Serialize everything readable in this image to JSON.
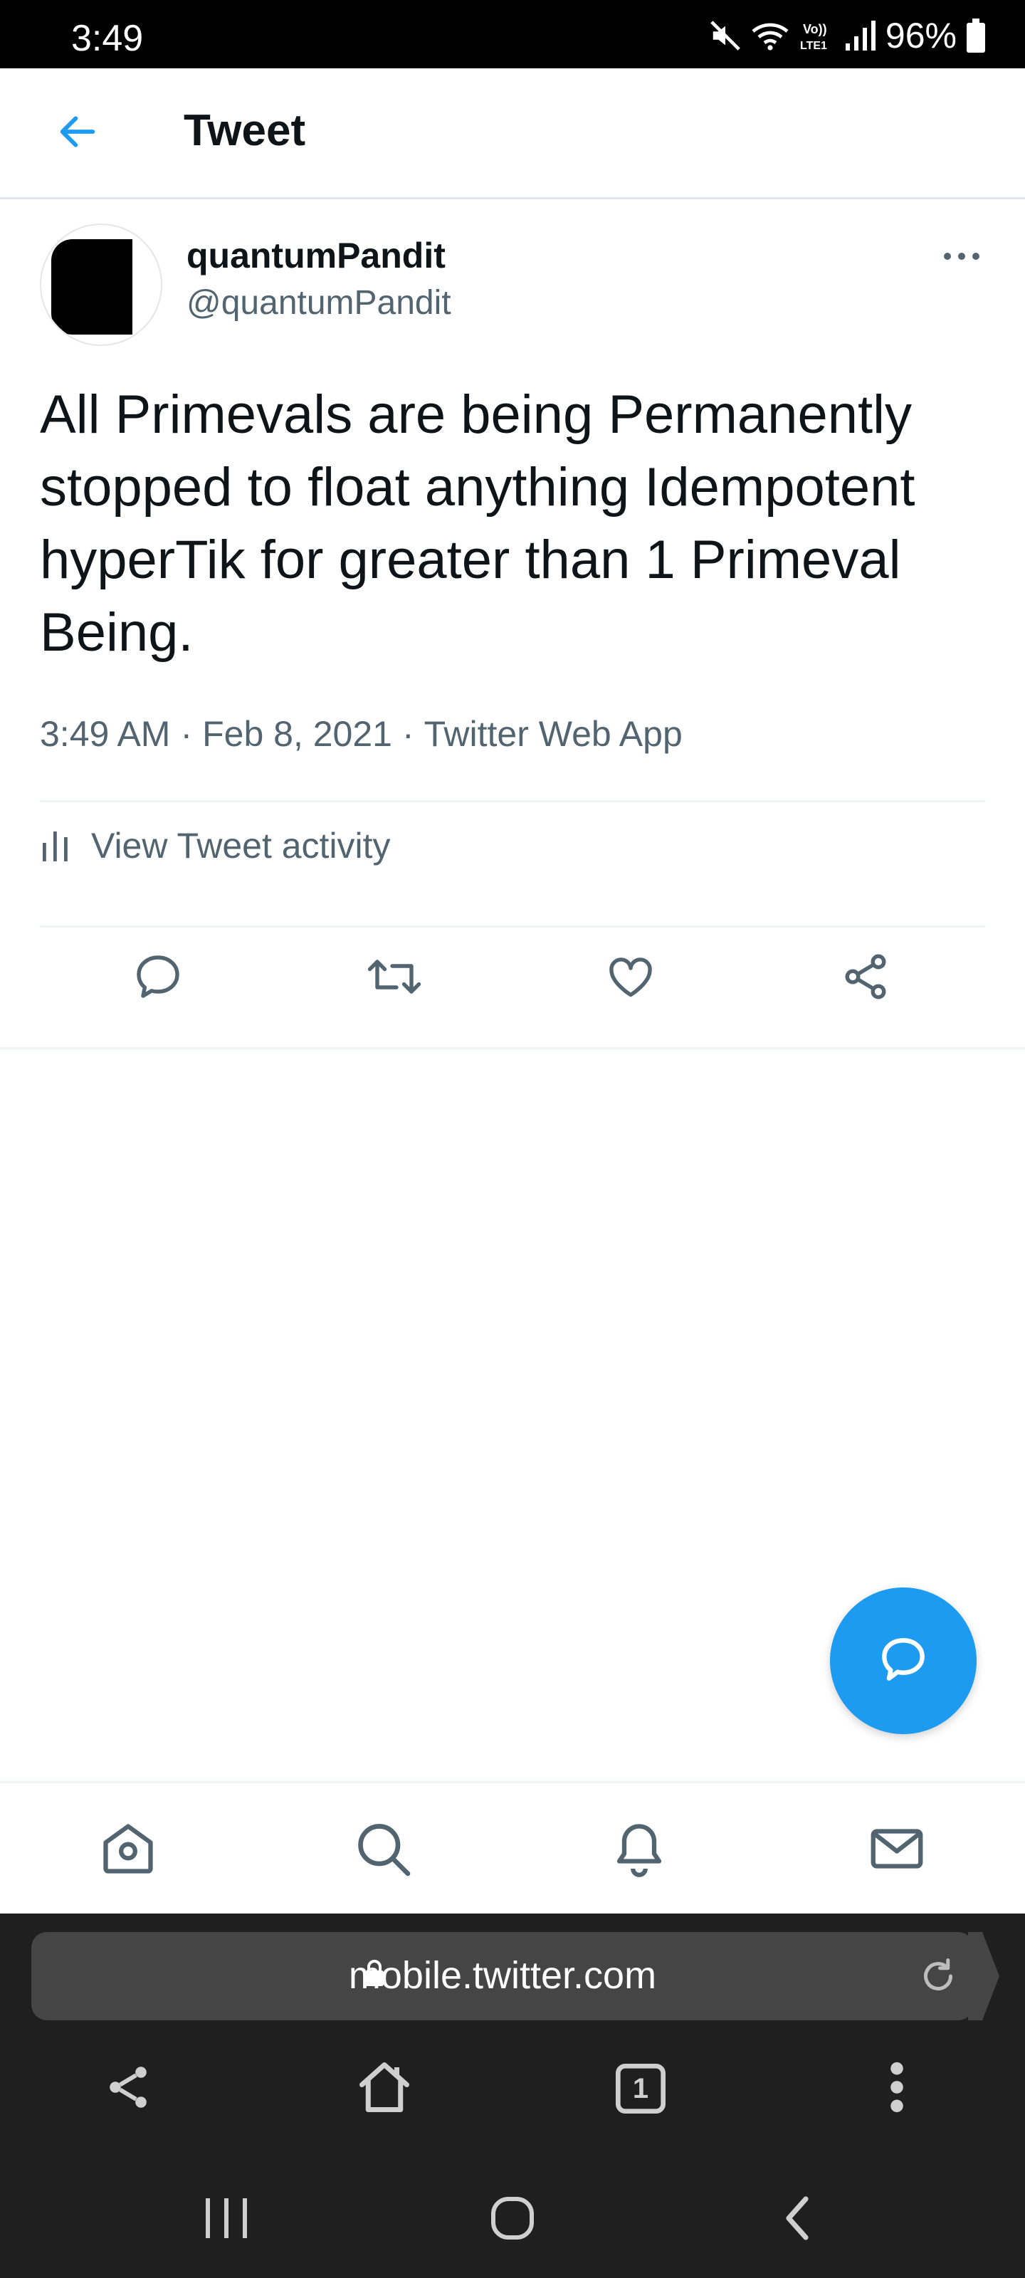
{
  "status_bar": {
    "time": "3:49",
    "battery": "96%",
    "icons": [
      "mute-icon",
      "wifi-icon",
      "volte-icon",
      "signal-icon",
      "battery-icon"
    ]
  },
  "header": {
    "title": "Tweet",
    "back_icon": "back-arrow-icon"
  },
  "tweet": {
    "author_name": "quantumPandit",
    "author_handle": "@quantumPandit",
    "text": "All Primevals are being Permanently stopped to float anything Idempotent hyperTik for greater than 1 Primeval Being.",
    "time": "3:49 AM",
    "date": "Feb 8, 2021",
    "source": "Twitter Web App",
    "separator": "·",
    "activity_label": "View Tweet activity",
    "actions": [
      "reply-icon",
      "retweet-icon",
      "like-icon",
      "share-icon"
    ]
  },
  "bottom_nav": [
    "home-icon",
    "search-icon",
    "notifications-icon",
    "messages-icon"
  ],
  "browser": {
    "url": "mobile.twitter.com",
    "tab_count": "1"
  },
  "colors": {
    "accent": "#1d9bf0",
    "text_primary": "#0f1419",
    "text_secondary": "#536471",
    "browser_bg": "#1f1f1f",
    "url_bar_bg": "#454545"
  }
}
